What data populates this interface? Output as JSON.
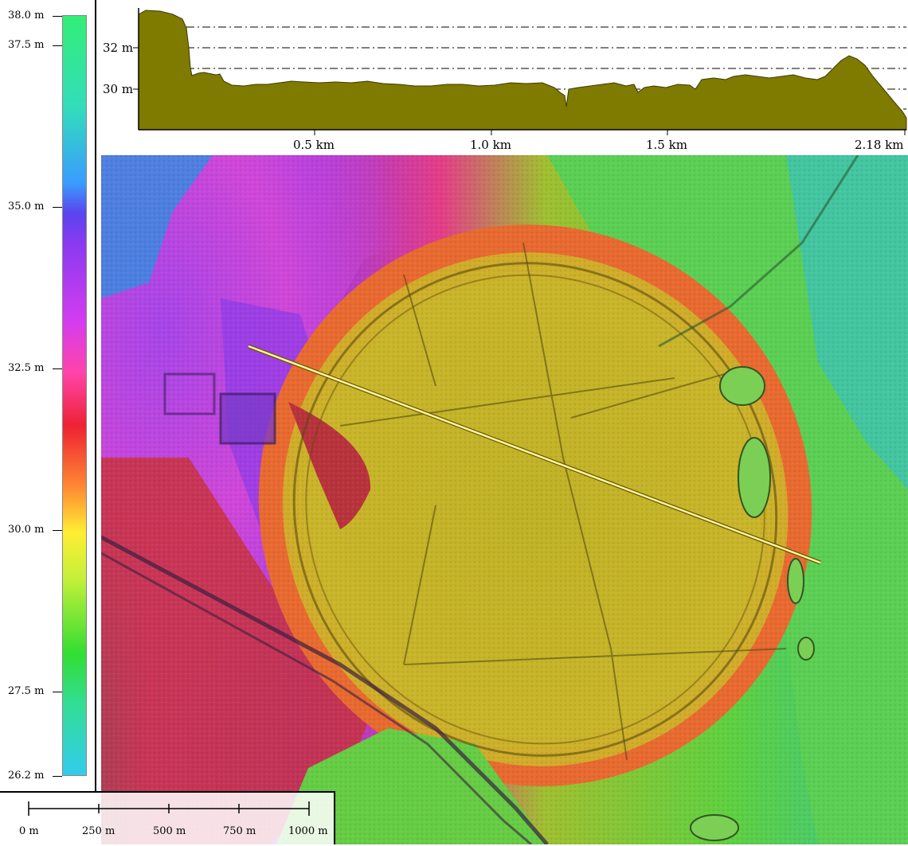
{
  "legend": {
    "labels": [
      "38.0 m",
      "37.5 m",
      "35.0 m",
      "32.5 m",
      "30.0 m",
      "27.5 m",
      "26.2 m"
    ]
  },
  "profile": {
    "y_labels": [
      "32 m",
      "30 m"
    ],
    "x_labels": [
      "0.5 km",
      "1.0 km",
      "1.5 km",
      "2.18 km"
    ],
    "fill_color": "#7f7a00"
  },
  "scalebar": {
    "labels": [
      "0 m",
      "250 m",
      "500 m",
      "750 m",
      "1000 m"
    ]
  },
  "map": {
    "profile_line_color": "#fff6a0"
  }
}
